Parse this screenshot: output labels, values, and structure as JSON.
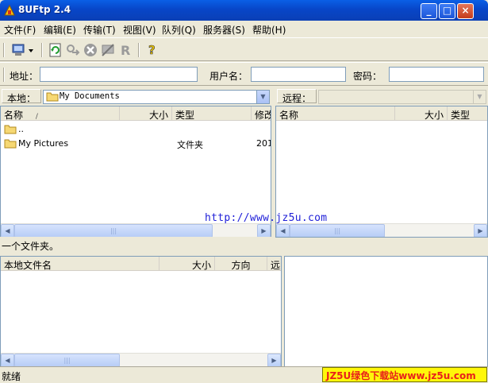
{
  "window": {
    "title": "8UFtp 2.4",
    "minimize": "_",
    "maximize": "□",
    "close": "×"
  },
  "menu": [
    "文件(F)",
    "编辑(E)",
    "传输(T)",
    "视图(V)",
    "队列(Q)",
    "服务器(S)",
    "帮助(H)"
  ],
  "toolbar": {
    "icons": [
      "site-manager-icon",
      "refresh-icon",
      "connect-icon",
      "cancel-icon",
      "disconnect-icon",
      "reconnect-icon",
      "help-icon"
    ]
  },
  "address": {
    "host_label": "地址：",
    "host_value": "",
    "user_label": "用户名：",
    "user_value": "",
    "password_label": "密码：",
    "password_value": ""
  },
  "local": {
    "label": "本地：",
    "path": "My Documents",
    "columns": [
      "名称",
      "大小",
      "类型",
      "修改"
    ],
    "sort_indicator": "/",
    "rows": [
      {
        "name": "..",
        "size": "",
        "type": "",
        "modified": ""
      },
      {
        "name": "My Pictures",
        "size": "",
        "type": "文件夹",
        "modified": "201"
      }
    ],
    "status": "一个文件夹。"
  },
  "remote": {
    "label": "远程：",
    "path": "",
    "columns": [
      "名称",
      "大小",
      "类型"
    ]
  },
  "queue": {
    "columns": [
      "本地文件名",
      "大小",
      "方向",
      "远"
    ]
  },
  "watermark_url": "http://www.jz5u.com",
  "status": {
    "text": "就绪"
  },
  "brand_banner": "JZ5U绿色下载站www.jz5u.com",
  "colors": {
    "titlebar": "#0846c8",
    "banner_bg": "#fff70a",
    "banner_text": "#e8221a",
    "watermark": "#2020d8"
  }
}
